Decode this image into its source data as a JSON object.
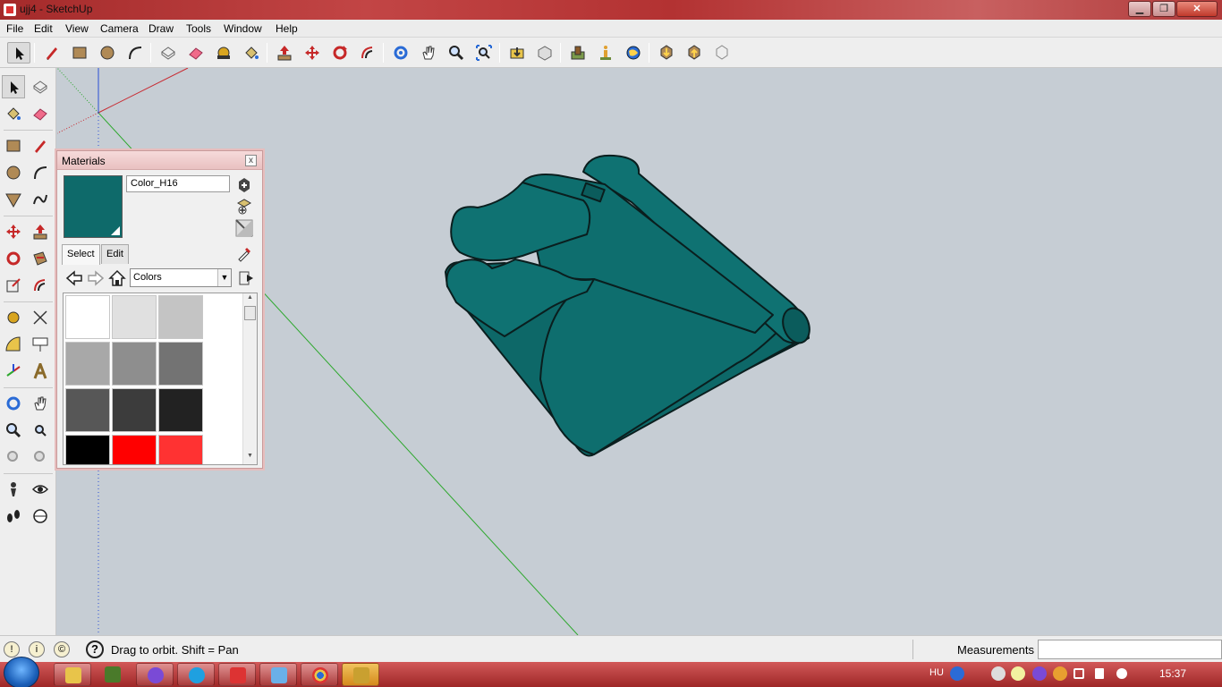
{
  "window": {
    "title": "ujj4 - SketchUp"
  },
  "menu": [
    "File",
    "Edit",
    "View",
    "Camera",
    "Draw",
    "Tools",
    "Window",
    "Help"
  ],
  "materials": {
    "title": "Materials",
    "close": "x",
    "name_value": "Color_H16",
    "current_color": "#0e6a6a",
    "tabs": [
      "Select",
      "Edit"
    ],
    "active_tab": "Select",
    "collection": "Colors",
    "swatches": [
      "#ffffff",
      "#e0e0e0",
      "#c4c4c4",
      "#a8a8a8",
      "#8e8e8e",
      "#737373",
      "#575757",
      "#3c3c3c",
      "#222222",
      "#000000",
      "#ff0000",
      "#ff3232"
    ]
  },
  "status": {
    "help_glyph": "?",
    "message": "Drag to orbit.  Shift = Pan",
    "measurements_label": "Measurements",
    "measurements_value": ""
  },
  "taskbar": {
    "lang": "HU",
    "time": "15:37"
  },
  "model": {
    "color": "#0e6a6a",
    "edge_color": "#0a1e1e"
  },
  "axes": {
    "red": "#c8282f",
    "green": "#2ea82e",
    "blue": "#2b4fd6"
  }
}
